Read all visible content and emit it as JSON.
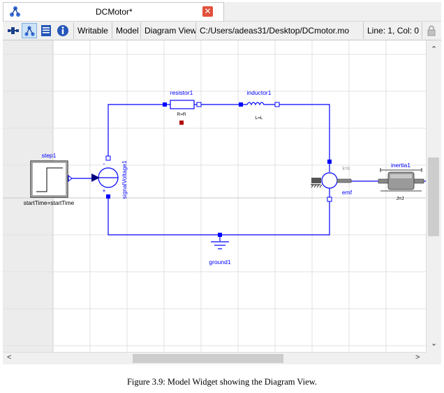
{
  "tab": {
    "title": "DCMotor*",
    "close_label": "✕"
  },
  "toolbar": {
    "writable_label": "Writable",
    "model_label": "Model",
    "view_label": "Diagram View",
    "path_label": "C:/Users/adeas31/Desktop/DCmotor.mo",
    "cursor_label": "Line: 1, Col: 0"
  },
  "diagram": {
    "components": {
      "step": {
        "name": "step1",
        "param": "startTime=startTime"
      },
      "signal_voltage": {
        "name": "signalVoltage1",
        "minus": "-",
        "plus": "+"
      },
      "resistor": {
        "name": "resistor1",
        "param": "R=R"
      },
      "inductor": {
        "name": "inductor1",
        "param": "L=L"
      },
      "emf": {
        "name": "emf",
        "param": "k=k"
      },
      "inertia": {
        "name": "inertia1",
        "param": "J=J"
      },
      "ground": {
        "name": "ground1"
      }
    },
    "colors": {
      "wire": "#0000ff",
      "label": "#0000ff",
      "grid": "#e4e4e4",
      "selected_connector": "#b00000"
    }
  },
  "scrollbars": {
    "up_arrow": "⌃",
    "down_arrow": "⌄",
    "left_arrow": "<",
    "right_arrow": ">"
  },
  "caption": "Figure 3.9: Model Widget showing the Diagram View."
}
